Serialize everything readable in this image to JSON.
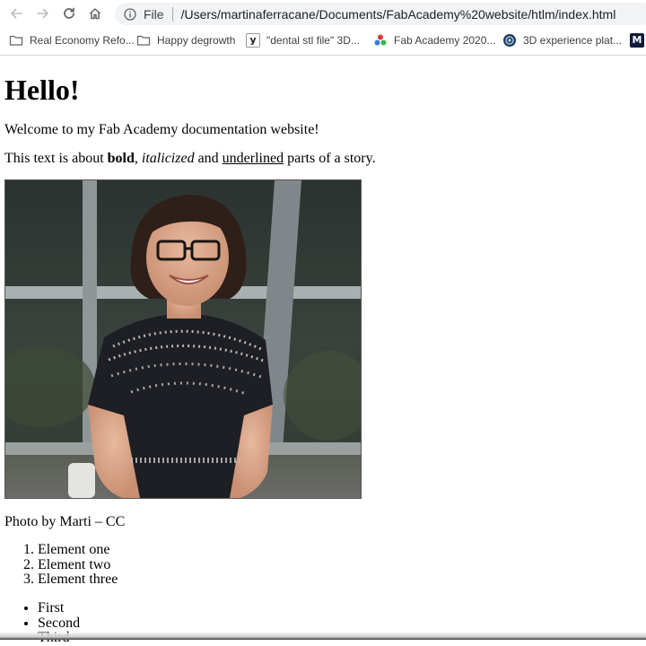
{
  "browser": {
    "scheme": "File",
    "url": "/Users/martinaferracane/Documents/FabAcademy%20website/htlm/index.html",
    "bookmarks": [
      {
        "label": "Real Economy Refo...",
        "icon": "folder-icon"
      },
      {
        "label": "Happy degrowth",
        "icon": "folder-icon"
      },
      {
        "label": "\"dental stl file\" 3D...",
        "icon": "yeggi-icon"
      },
      {
        "label": "Fab Academy 2020...",
        "icon": "fab-icon"
      },
      {
        "label": "3D experience plat...",
        "icon": "compass-icon"
      }
    ],
    "overflow_icon_letter": "M"
  },
  "page": {
    "heading": "Hello!",
    "welcome": "Welcome to my Fab Academy documentation website!",
    "text_parts": {
      "pre": "This text is about ",
      "bold": "bold",
      "comma": ", ",
      "italic": "italicized",
      "and": " and ",
      "underline": "underlined",
      "post": " parts of a story."
    },
    "caption": "Photo by Marti – CC",
    "ordered_list": [
      "Element one",
      "Element two",
      "Element three"
    ],
    "unordered_list": [
      "First",
      "Second",
      "Third"
    ]
  },
  "colors": {
    "chrome_icon": "#5f6368",
    "omnibox_bg": "#f1f3f4"
  }
}
